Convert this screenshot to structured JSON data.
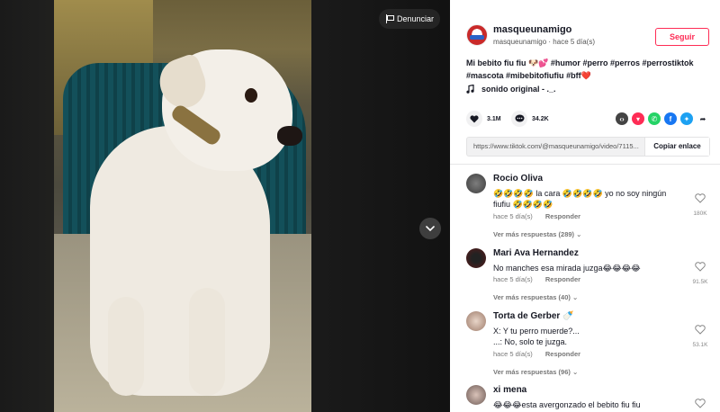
{
  "video": {
    "report_label": "Denunciar"
  },
  "author": {
    "username": "masqueunamigo",
    "handle": "masqueunamigo",
    "separator": "·",
    "posted": "hace 5 día(s)",
    "follow_label": "Seguir"
  },
  "caption": {
    "text": "Mi bebito fiu fiu 🐶💕",
    "tags": [
      "#humor",
      "#perro",
      "#perros",
      "#perrostiktok",
      "#mascota",
      "#mibebitofiufiu",
      "#bff"
    ],
    "end_emoji": "❤️"
  },
  "sound": {
    "label": "sonido original - ._."
  },
  "stats": {
    "likes": "3.1M",
    "comments": "34.2K"
  },
  "share": {
    "link": "https://www.tiktok.com/@masqueunamigo/video/7115...",
    "copy_label": "Copiar enlace",
    "icons": [
      "embed-icon",
      "send-icon",
      "whatsapp-icon",
      "facebook-icon",
      "twitter-icon",
      "share-arrow-icon"
    ]
  },
  "comments": [
    {
      "name": "Rocio Oliva",
      "text": "🤣🤣🤣🤣 la cara 🤣🤣🤣🤣 yo no soy ningún fiufiu 🤣🤣🤣🤣",
      "time": "hace 5 día(s)",
      "reply": "Responder",
      "likes": "180K",
      "more": "Ver más respuestas (289)"
    },
    {
      "name": "Mari Ava Hernandez",
      "text": "No manches esa mirada juzga😂😂😂😂",
      "time": "hace 5 día(s)",
      "reply": "Responder",
      "likes": "91.5K",
      "more": "Ver más respuestas (40)"
    },
    {
      "name": "Torta de Gerber 🍼",
      "text": "X: Y tu perro muerde?...\n...: No, solo te juzga.",
      "time": "hace 5 día(s)",
      "reply": "Responder",
      "likes": "53.1K",
      "more": "Ver más respuestas (96)"
    },
    {
      "name": "xi mena",
      "text": "😂😂😂esta avergonzado el bebito fiu fiu",
      "time": "",
      "reply": "",
      "likes": "",
      "more": ""
    }
  ]
}
